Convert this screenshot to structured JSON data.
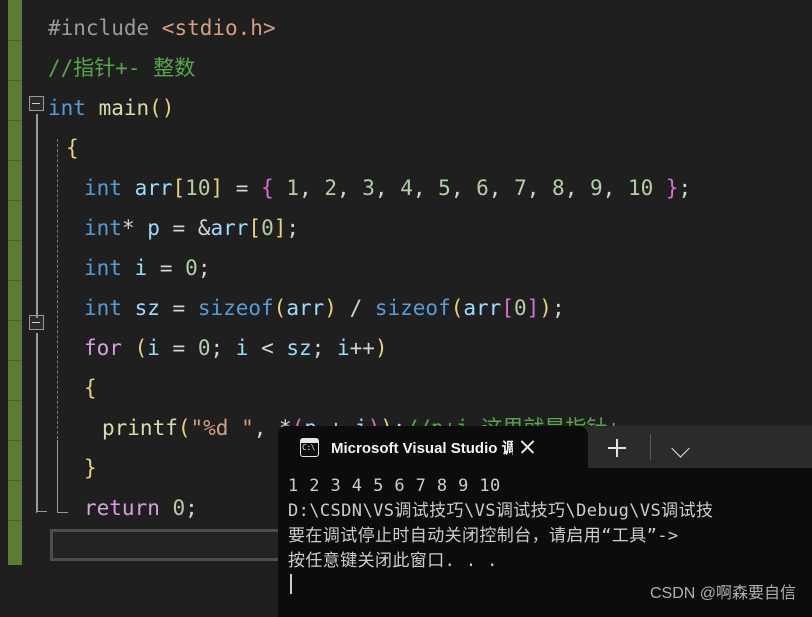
{
  "editor": {
    "theme_background": "#1f1f1f",
    "change_bar_color": "#5d7b35",
    "lines": [
      {
        "indent": 0,
        "tokens": [
          {
            "c": "t-pre",
            "t": "#include "
          },
          {
            "c": "t-str",
            "t": "<stdio.h>"
          }
        ]
      },
      {
        "indent": 0,
        "tokens": [
          {
            "c": "t-cmt",
            "t": "//指针+- 整数"
          }
        ]
      },
      {
        "indent": 0,
        "tokens": [
          {
            "c": "t-kw",
            "t": "int "
          },
          {
            "c": "t-fn",
            "t": "main"
          },
          {
            "c": "t-brk1",
            "t": "()"
          }
        ]
      },
      {
        "indent": 1,
        "tokens": [
          {
            "c": "t-brk1",
            "t": "{"
          }
        ]
      },
      {
        "indent": 2,
        "tokens": [
          {
            "c": "t-kw",
            "t": "int "
          },
          {
            "c": "t-var",
            "t": "arr"
          },
          {
            "c": "t-brk1",
            "t": "["
          },
          {
            "c": "t-num",
            "t": "10"
          },
          {
            "c": "t-brk1",
            "t": "]"
          },
          {
            "c": "t-plain",
            "t": " = "
          },
          {
            "c": "t-brk2",
            "t": "{"
          },
          {
            "c": "t-num",
            "t": " 1"
          },
          {
            "c": "t-plain",
            "t": ","
          },
          {
            "c": "t-num",
            "t": " 2"
          },
          {
            "c": "t-plain",
            "t": ","
          },
          {
            "c": "t-num",
            "t": " 3"
          },
          {
            "c": "t-plain",
            "t": ","
          },
          {
            "c": "t-num",
            "t": " 4"
          },
          {
            "c": "t-plain",
            "t": ","
          },
          {
            "c": "t-num",
            "t": " 5"
          },
          {
            "c": "t-plain",
            "t": ","
          },
          {
            "c": "t-num",
            "t": " 6"
          },
          {
            "c": "t-plain",
            "t": ","
          },
          {
            "c": "t-num",
            "t": " 7"
          },
          {
            "c": "t-plain",
            "t": ","
          },
          {
            "c": "t-num",
            "t": " 8"
          },
          {
            "c": "t-plain",
            "t": ","
          },
          {
            "c": "t-num",
            "t": " 9"
          },
          {
            "c": "t-plain",
            "t": ","
          },
          {
            "c": "t-num",
            "t": " 10"
          },
          {
            "c": "t-brk2",
            "t": " }"
          },
          {
            "c": "t-plain",
            "t": ";"
          }
        ]
      },
      {
        "indent": 2,
        "tokens": [
          {
            "c": "t-kw",
            "t": "int"
          },
          {
            "c": "t-plain",
            "t": "* "
          },
          {
            "c": "t-var",
            "t": "p"
          },
          {
            "c": "t-plain",
            "t": " = &"
          },
          {
            "c": "t-var",
            "t": "arr"
          },
          {
            "c": "t-brk1",
            "t": "["
          },
          {
            "c": "t-num",
            "t": "0"
          },
          {
            "c": "t-brk1",
            "t": "]"
          },
          {
            "c": "t-plain",
            "t": ";"
          }
        ]
      },
      {
        "indent": 2,
        "tokens": [
          {
            "c": "t-kw",
            "t": "int "
          },
          {
            "c": "t-var",
            "t": "i"
          },
          {
            "c": "t-plain",
            "t": " = "
          },
          {
            "c": "t-num",
            "t": "0"
          },
          {
            "c": "t-plain",
            "t": ";"
          }
        ]
      },
      {
        "indent": 2,
        "tokens": [
          {
            "c": "t-kw",
            "t": "int "
          },
          {
            "c": "t-var",
            "t": "sz"
          },
          {
            "c": "t-plain",
            "t": " = "
          },
          {
            "c": "t-kw",
            "t": "sizeof"
          },
          {
            "c": "t-brk1",
            "t": "("
          },
          {
            "c": "t-var",
            "t": "arr"
          },
          {
            "c": "t-brk1",
            "t": ")"
          },
          {
            "c": "t-plain",
            "t": " / "
          },
          {
            "c": "t-kw",
            "t": "sizeof"
          },
          {
            "c": "t-brk1",
            "t": "("
          },
          {
            "c": "t-var",
            "t": "arr"
          },
          {
            "c": "t-brk2",
            "t": "["
          },
          {
            "c": "t-num",
            "t": "0"
          },
          {
            "c": "t-brk2",
            "t": "]"
          },
          {
            "c": "t-brk1",
            "t": ")"
          },
          {
            "c": "t-plain",
            "t": ";"
          }
        ]
      },
      {
        "indent": 2,
        "tokens": [
          {
            "c": "t-ctrl",
            "t": "for "
          },
          {
            "c": "t-brk1",
            "t": "("
          },
          {
            "c": "t-var",
            "t": "i"
          },
          {
            "c": "t-plain",
            "t": " = "
          },
          {
            "c": "t-num",
            "t": "0"
          },
          {
            "c": "t-plain",
            "t": "; "
          },
          {
            "c": "t-var",
            "t": "i"
          },
          {
            "c": "t-plain",
            "t": " < "
          },
          {
            "c": "t-var",
            "t": "sz"
          },
          {
            "c": "t-plain",
            "t": "; "
          },
          {
            "c": "t-var",
            "t": "i"
          },
          {
            "c": "t-plain",
            "t": "++"
          },
          {
            "c": "t-brk1",
            "t": ")"
          }
        ]
      },
      {
        "indent": 2,
        "tokens": [
          {
            "c": "t-brk1",
            "t": "{"
          }
        ]
      },
      {
        "indent": 3,
        "tokens": [
          {
            "c": "t-fn",
            "t": "printf"
          },
          {
            "c": "t-brk1",
            "t": "("
          },
          {
            "c": "t-str",
            "t": "\"%d \""
          },
          {
            "c": "t-plain",
            "t": ", *"
          },
          {
            "c": "t-brk2",
            "t": "("
          },
          {
            "c": "t-var",
            "t": "p"
          },
          {
            "c": "t-plain",
            "t": " + "
          },
          {
            "c": "t-var",
            "t": "i"
          },
          {
            "c": "t-brk2",
            "t": ")"
          },
          {
            "c": "t-brk1",
            "t": ")"
          },
          {
            "c": "t-plain",
            "t": ";"
          },
          {
            "c": "t-cmt",
            "t": "//p+i 这里就是指针+"
          }
        ]
      },
      {
        "indent": 2,
        "tokens": [
          {
            "c": "t-brk1",
            "t": "}"
          }
        ]
      },
      {
        "indent": 2,
        "tokens": [
          {
            "c": "t-ctrl",
            "t": "return "
          },
          {
            "c": "t-num",
            "t": "0"
          },
          {
            "c": "t-plain",
            "t": ";"
          }
        ]
      },
      {
        "indent": 1,
        "tokens": [
          {
            "c": "t-brk1",
            "t": "}"
          }
        ]
      }
    ]
  },
  "terminal": {
    "tab": {
      "icon": "console-icon",
      "icon_glyph": "C:\\",
      "title": "Microsoft Visual Studio 调试控",
      "close_label": "×"
    },
    "new_tab_label": "+",
    "dropdown_label": "⌄",
    "output_lines": [
      "1 2 3 4 5 6 7 8 9 10",
      "D:\\CSDN\\VS调试技巧\\VS调试技巧\\Debug\\VS调试技",
      "要在调试停止时自动关闭控制台，请启用“工具”->",
      "按任意键关闭此窗口. . ."
    ]
  },
  "watermark": {
    "text": "CSDN @啊森要自信"
  }
}
